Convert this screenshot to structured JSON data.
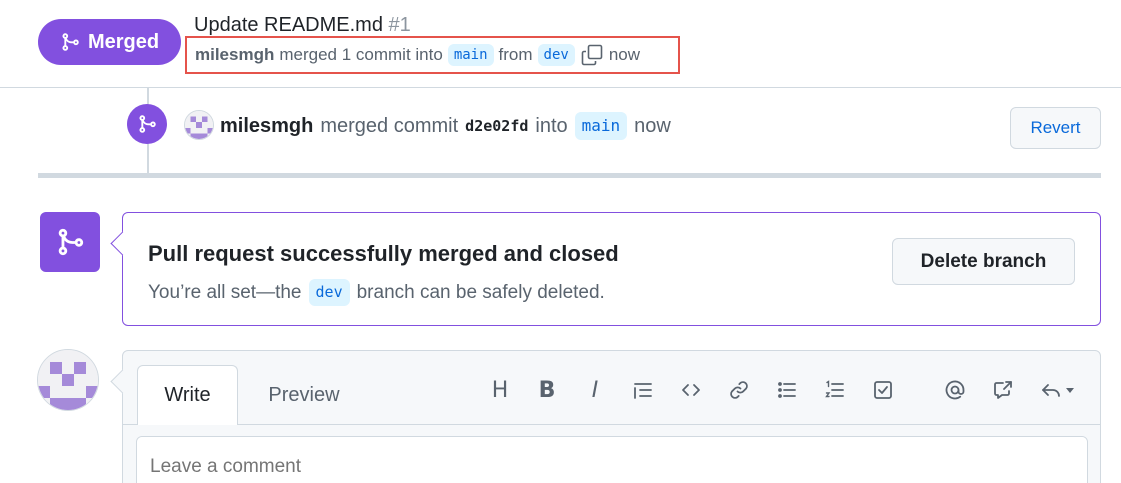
{
  "header": {
    "state_label": "Merged",
    "title": "Update README.md",
    "number": "#1",
    "meta": {
      "author": "milesmgh",
      "action": "merged 1 commit into",
      "base_branch": "main",
      "from_word": "from",
      "head_branch": "dev",
      "time": "now"
    }
  },
  "timeline_event": {
    "author": "milesmgh",
    "action": "merged commit",
    "sha": "d2e02fd",
    "into_word": "into",
    "branch": "main",
    "time": "now",
    "revert_label": "Revert"
  },
  "merge_box": {
    "heading": "Pull request successfully merged and closed",
    "sub_before": "You’re all set—the",
    "branch": "dev",
    "sub_after": "branch can be safely deleted.",
    "delete_label": "Delete branch"
  },
  "editor": {
    "tabs": [
      "Write",
      "Preview"
    ],
    "placeholder": "Leave a comment",
    "toolbar": {
      "heading": "H",
      "bold": "B",
      "italic": "I"
    }
  },
  "colors": {
    "merged_purple": "#8250df",
    "link_blue": "#0969da",
    "highlight_red": "#e5534b"
  }
}
